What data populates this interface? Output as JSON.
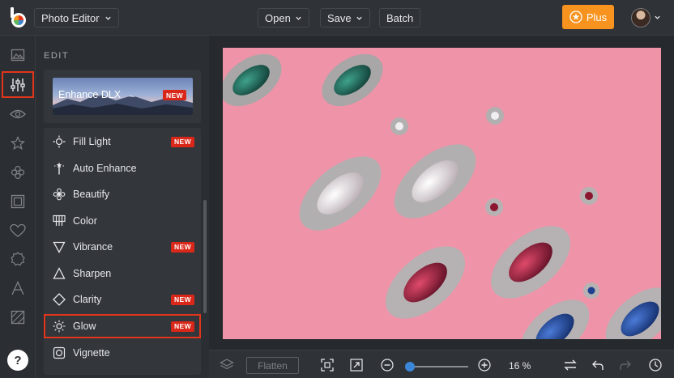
{
  "header": {
    "app_menu_label": "Photo Editor",
    "open_label": "Open",
    "save_label": "Save",
    "batch_label": "Batch",
    "plus_label": "Plus"
  },
  "rail": {
    "items": [
      "image-icon",
      "sliders-icon",
      "eye-icon",
      "star-icon",
      "flower-icon",
      "frame-icon",
      "heart-icon",
      "badge-icon",
      "text-icon",
      "texture-icon"
    ],
    "active_index": 1,
    "help_label": "?"
  },
  "panel": {
    "title": "EDIT",
    "featured": {
      "label": "Enhance DLX",
      "badge": "NEW"
    },
    "tools": [
      {
        "label": "Fill Light",
        "icon": "fill-light-icon",
        "badge": "NEW",
        "selected": false
      },
      {
        "label": "Auto Enhance",
        "icon": "auto-enhance-icon",
        "badge": "",
        "selected": false
      },
      {
        "label": "Beautify",
        "icon": "beautify-icon",
        "badge": "",
        "selected": false
      },
      {
        "label": "Color",
        "icon": "color-icon",
        "badge": "",
        "selected": false
      },
      {
        "label": "Vibrance",
        "icon": "vibrance-icon",
        "badge": "NEW",
        "selected": false
      },
      {
        "label": "Sharpen",
        "icon": "sharpen-icon",
        "badge": "",
        "selected": false
      },
      {
        "label": "Clarity",
        "icon": "clarity-icon",
        "badge": "NEW",
        "selected": false
      },
      {
        "label": "Glow",
        "icon": "glow-icon",
        "badge": "NEW",
        "selected": true
      },
      {
        "label": "Vignette",
        "icon": "vignette-icon",
        "badge": "",
        "selected": false
      }
    ]
  },
  "bottombar": {
    "flatten_label": "Flatten",
    "zoom_label": "16 %",
    "zoom_fraction": 0.0
  },
  "colors": {
    "accent": "#f7931e",
    "highlight": "#e2351a",
    "new_badge": "#d9281a",
    "slider": "#3a86d8",
    "photo_background": "#ef93a8"
  }
}
